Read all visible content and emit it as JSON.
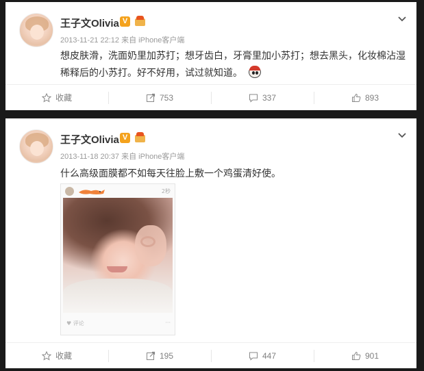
{
  "posts": [
    {
      "username": "王子文Olivia",
      "verified_badge": "V",
      "timestamp": "2013-11-21 22:12",
      "source": "来自 iPhone客户端",
      "text": "想皮肤滑，洗面奶里加苏打；想牙齿白，牙膏里加小苏打；想去黑头，化妆棉沾湿稀释后的小苏打。好不好用，试过就知道。",
      "emoji": "panda-face-emoji",
      "actions": {
        "favorite_label": "收藏",
        "repost_count": "753",
        "comment_count": "337",
        "like_count": "893"
      }
    },
    {
      "username": "王子文Olivia",
      "verified_badge": "V",
      "timestamp": "2013-11-18 20:37",
      "source": "来自 iPhone客户端",
      "text": "什么高级面膜都不如每天往脸上敷一个鸡蛋清好使。",
      "photo": {
        "subject": "selfie-photo",
        "header_time": "2秒",
        "footer_left": "♥ 评论",
        "footer_right": "···"
      },
      "actions": {
        "favorite_label": "收藏",
        "repost_count": "195",
        "comment_count": "447",
        "like_count": "901"
      }
    }
  ],
  "colors": {
    "background": "#1a1a1a",
    "card": "#ffffff",
    "username": "#333333",
    "meta": "#999999",
    "verified_badge": "#f4a21d",
    "action_text": "#808080"
  }
}
